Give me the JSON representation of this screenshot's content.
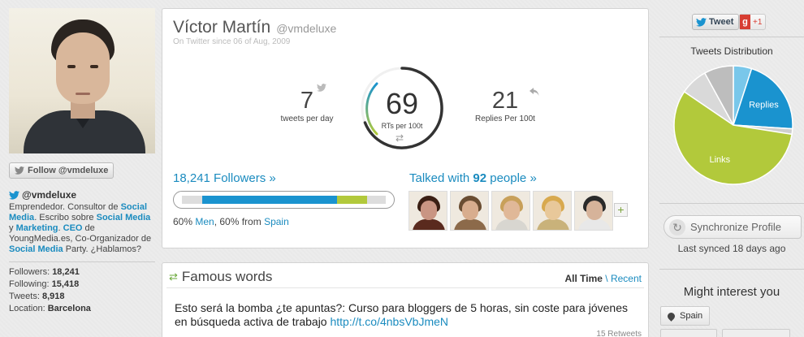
{
  "left": {
    "follow_label": "Follow @vmdeluxe",
    "bio_handle": "@vmdeluxe",
    "bio_parts": {
      "p1": "Emprendedor. Consultor de ",
      "b1": "Social Media",
      "p2": ". Escribo sobre ",
      "b2": "Social Media",
      "p3": " y ",
      "b3": "Marketing",
      "p4": ". ",
      "b4": "CEO",
      "p5": " de YoungMedia.es, Co-Organizador de ",
      "b5": "Social Media",
      "p6": " Party. ¿Hablamos?"
    },
    "stats": [
      {
        "label": "Followers:",
        "value": "18,241"
      },
      {
        "label": "Following:",
        "value": "15,418"
      },
      {
        "label": "Tweets:",
        "value": "8,918"
      },
      {
        "label": "Location:",
        "value": "Barcelona"
      }
    ]
  },
  "profile": {
    "name": "Víctor Martín",
    "handle": "@vmdeluxe",
    "since": "On Twitter since 06 of Aug, 2009",
    "tweets_per_day": "7",
    "tweets_per_day_label": "tweets per day",
    "rts_per_100": "69",
    "rts_label": "RTs per 100t",
    "replies_per_100": "21",
    "replies_label": "Replies Per 100t",
    "followers_link": "18,241 Followers »",
    "bar_men_fraction": 0.6,
    "bar_green_fraction": 0.15,
    "bar_caption_pct_men": "60% ",
    "bar_caption_men": "Men",
    "bar_caption_mid": ", 60% from ",
    "bar_caption_country": "Spain",
    "talked_pre": "Talked with ",
    "talked_num": "92",
    "talked_post": " people »",
    "more_symbol": "+",
    "people_colors": [
      {
        "hair": "#3b1f14",
        "face": "#c99583",
        "body": "#5a2a1e"
      },
      {
        "hair": "#6a4d32",
        "face": "#d8ad8e",
        "body": "#8c6a4a"
      },
      {
        "hair": "#c8a05a",
        "face": "#e0b898",
        "body": "#d8d6d0"
      },
      {
        "hair": "#d8a94e",
        "face": "#e8c89a",
        "body": "#c9b27a"
      },
      {
        "hair": "#2a2a2a",
        "face": "#d6b39a",
        "body": "#e8e8e8"
      }
    ]
  },
  "famous": {
    "title": "Famous words",
    "filter_active": "All Time",
    "filter_sep": " \\ ",
    "filter_other": "Recent",
    "text": "Esto será la bomba ¿te apuntas?: Curso para bloggers de 5 horas, sin coste para jóvenes en búsqueda activa de trabajo ",
    "link": "http://t.co/4nbsVbJmeN",
    "retweets": "15 Retweets"
  },
  "right": {
    "tweet_label": "Tweet",
    "gplus_g": "g",
    "gplus_label": "+1",
    "dist_title": "Tweets Distribution",
    "sync_label": "Synchronize Profile",
    "sync_time": "Last synced 18 days ago",
    "might_title": "Might interest you",
    "tag_spain": "Spain"
  },
  "chart_data": {
    "type": "pie",
    "title": "Tweets Distribution",
    "slices": [
      {
        "name": "",
        "value": 5,
        "color": "#79c7ea"
      },
      {
        "name": "Replies",
        "value": 21,
        "color": "#1a93cf"
      },
      {
        "name": "",
        "value": 1.5,
        "color": "#cfcfcf"
      },
      {
        "name": "Links",
        "value": 57,
        "color": "#b2c93b"
      },
      {
        "name": "",
        "value": 7.5,
        "color": "#d9d9d9"
      },
      {
        "name": "",
        "value": 8,
        "color": "#bdbdbd"
      }
    ]
  },
  "colors": {
    "accent": "#1a8bbf",
    "green": "#b2c93b",
    "blue": "#1a93cf"
  }
}
